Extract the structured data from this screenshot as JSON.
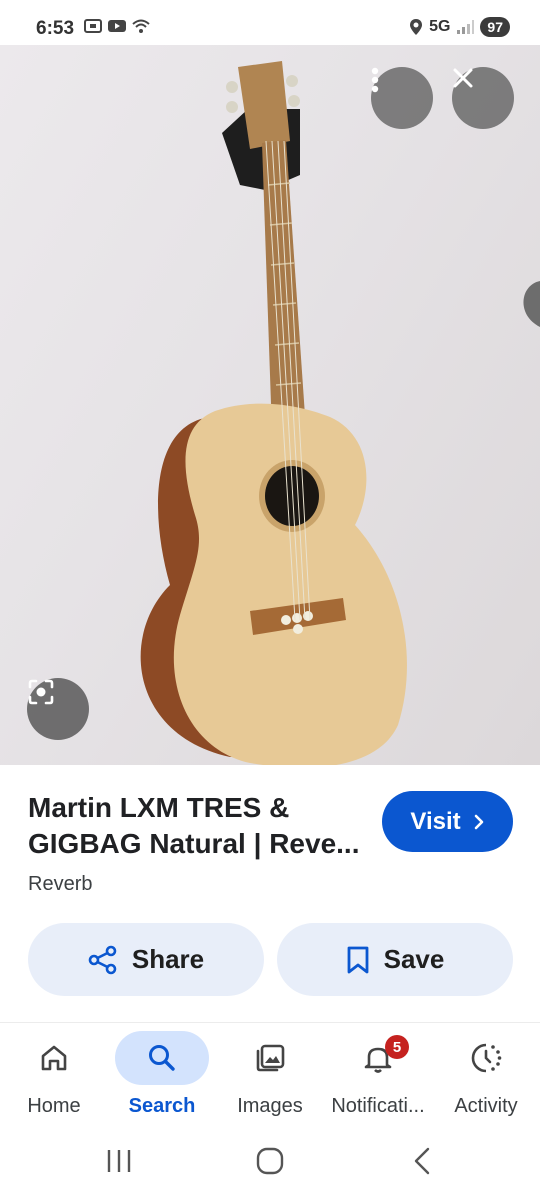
{
  "status_bar": {
    "time": "6:53",
    "network": "5G",
    "battery": "97",
    "icons": [
      "screenshot-icon",
      "youtube-icon",
      "wifi-icon",
      "location-icon",
      "signal-icon"
    ]
  },
  "image_viewer": {
    "subject": "acoustic bass guitar on wall hanger",
    "buttons": [
      "more-options-icon",
      "close-icon",
      "lens-icon"
    ]
  },
  "result": {
    "title": "Martin LXM TRES & GIGBAG Natural | Reve...",
    "source": "Reverb",
    "visit_label": "Visit"
  },
  "actions": {
    "share_label": "Share",
    "save_label": "Save"
  },
  "bottom_nav": {
    "items": [
      {
        "label": "Home",
        "icon": "home-icon"
      },
      {
        "label": "Search",
        "icon": "search-icon",
        "active": true
      },
      {
        "label": "Images",
        "icon": "images-icon"
      },
      {
        "label": "Notificati...",
        "icon": "bell-icon",
        "badge": "5"
      },
      {
        "label": "Activity",
        "icon": "activity-icon"
      }
    ]
  },
  "colors": {
    "accent": "#0b57d0",
    "chip_bg": "#e8eef9",
    "active_nav_bg": "#d3e3fd",
    "badge": "#c5221f"
  }
}
